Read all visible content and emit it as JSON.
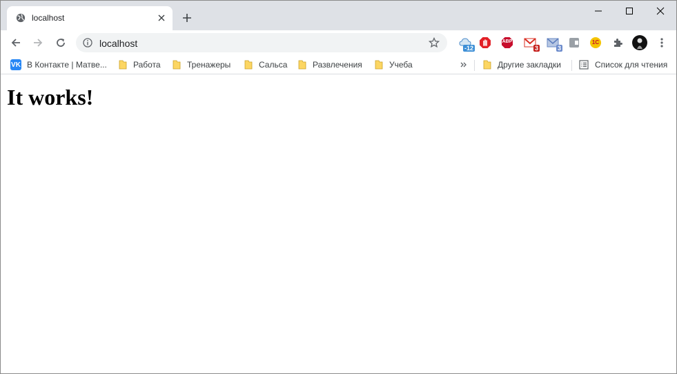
{
  "tab": {
    "title": "localhost"
  },
  "omnibox": {
    "url": "localhost"
  },
  "extensions": [
    {
      "name": "weather-extension",
      "badge": "-12"
    },
    {
      "name": "adblock-stop-extension",
      "badge": ""
    },
    {
      "name": "adblock-plus-extension",
      "badge": "ABP"
    },
    {
      "name": "gmail-checker-extension",
      "badge": "3"
    },
    {
      "name": "mail-checker-extension",
      "badge": "3"
    },
    {
      "name": "gray-extension",
      "badge": ""
    },
    {
      "name": "1c-extension",
      "badge": "1С"
    }
  ],
  "bookmarks": {
    "items": [
      {
        "label": "В Контакте | Матве..."
      },
      {
        "label": "Работа"
      },
      {
        "label": "Тренажеры"
      },
      {
        "label": "Сальса"
      },
      {
        "label": "Развлечения"
      },
      {
        "label": "Учеба"
      }
    ],
    "other": "Другие закладки",
    "reading_list": "Список для чтения"
  },
  "page": {
    "heading": "It works!"
  },
  "colors": {
    "tabstrip": "#dee1e6",
    "omnibox": "#f1f3f4",
    "folder": "#fcd663",
    "vk": "#2787f5"
  }
}
